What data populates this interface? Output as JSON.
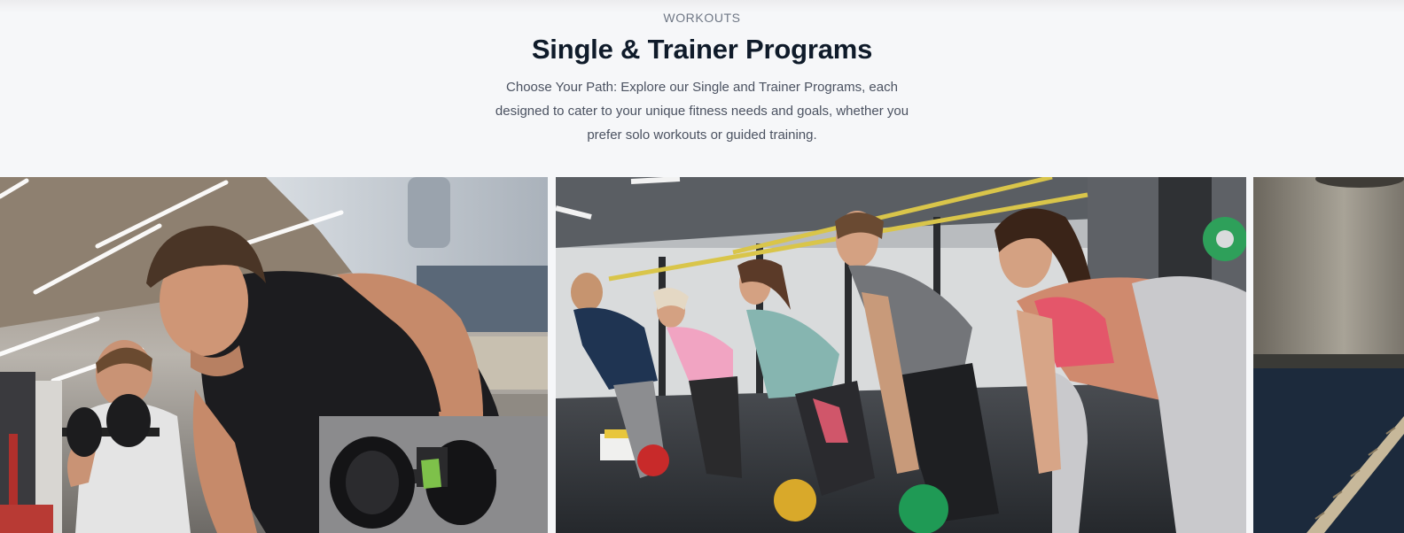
{
  "section": {
    "eyebrow": "WORKOUTS",
    "title": "Single & Trainer Programs",
    "description": "Choose Your Path: Explore our Single and Trainer Programs, each designed to cater to your unique fitness needs and goals, whether you prefer solo workouts or guided training."
  },
  "gallery": {
    "cards": [
      {
        "image": "gym-dumbbell-row-photo"
      },
      {
        "image": "group-kettlebell-class-photo"
      },
      {
        "image": "battle-rope-photo"
      }
    ]
  },
  "colors": {
    "title": "#0f1b2a",
    "eyebrow": "#6f7785",
    "description": "#4b5261",
    "background": "#f6f7f9"
  }
}
